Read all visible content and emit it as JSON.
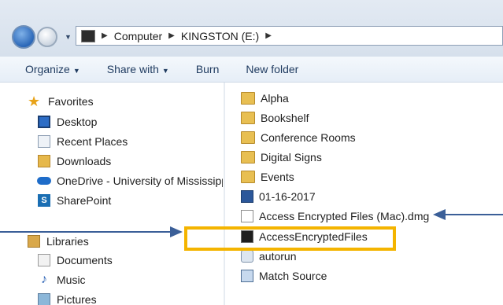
{
  "window": {
    "address_bar": [
      "Computer",
      "KINGSTON (E:)"
    ],
    "nav_icons": {
      "back": "back-arrow-icon",
      "forward": "forward-arrow-icon",
      "recent": "chevron-down-icon"
    }
  },
  "toolbar": {
    "items": [
      {
        "label": "Organize",
        "dropdown": true
      },
      {
        "label": "Share with",
        "dropdown": true
      },
      {
        "label": "Burn",
        "dropdown": false
      },
      {
        "label": "New folder",
        "dropdown": false
      }
    ]
  },
  "navpane": {
    "favorites": {
      "label": "Favorites",
      "items": [
        {
          "label": "Desktop",
          "icon": "desktop-icon"
        },
        {
          "label": "Recent Places",
          "icon": "recent-places-icon"
        },
        {
          "label": "Downloads",
          "icon": "downloads-icon"
        },
        {
          "label": "OneDrive - University of Mississippi",
          "icon": "onedrive-icon"
        },
        {
          "label": "SharePoint",
          "icon": "sharepoint-icon"
        }
      ]
    },
    "libraries": {
      "label": "Libraries",
      "items": [
        {
          "label": "Documents",
          "icon": "documents-icon"
        },
        {
          "label": "Music",
          "icon": "music-icon"
        },
        {
          "label": "Pictures",
          "icon": "pictures-icon"
        }
      ]
    }
  },
  "files": [
    {
      "name": "Alpha",
      "icon": "folder-icon"
    },
    {
      "name": "Bookshelf",
      "icon": "folder-icon"
    },
    {
      "name": "Conference Rooms",
      "icon": "folder-icon"
    },
    {
      "name": "Digital Signs",
      "icon": "folder-icon"
    },
    {
      "name": "Events",
      "icon": "folder-icon"
    },
    {
      "name": "01-16-2017",
      "icon": "word-document-icon"
    },
    {
      "name": "Access Encrypted Files (Mac).dmg",
      "icon": "file-icon"
    },
    {
      "name": "AccessEncryptedFiles",
      "icon": "application-icon"
    },
    {
      "name": "autorun",
      "icon": "autorun-icon"
    },
    {
      "name": "Match Source",
      "icon": "match-source-icon"
    }
  ],
  "annotations": {
    "highlight_color": "#f4b400",
    "arrow_color": "#3b5f98",
    "highlighted_file": "AccessEncryptedFiles",
    "arrow_targets": [
      "AccessEncryptedFiles",
      "Access Encrypted Files (Mac).dmg"
    ]
  }
}
